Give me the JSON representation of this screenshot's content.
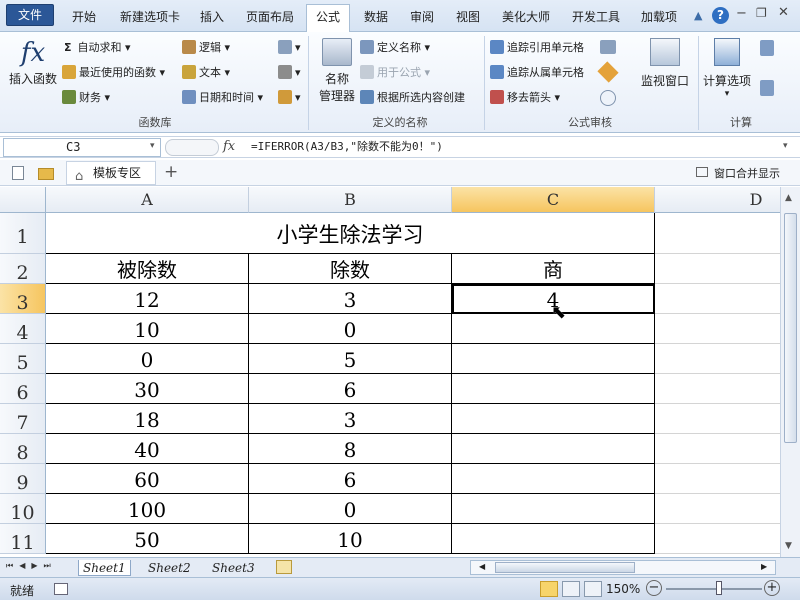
{
  "ribbon_tabs": [
    "文件",
    "开始",
    "新建选项卡",
    "插入",
    "页面布局",
    "公式",
    "数据",
    "审阅",
    "视图",
    "美化大师",
    "开发工具",
    "加载项"
  ],
  "active_tab": "公式",
  "ribbon": {
    "insert_function": "插入函数",
    "fx_glyph": "fx",
    "autosum": "自动求和",
    "recent": "最近使用的函数",
    "finance": "财务",
    "logic": "逻辑",
    "text": "文本",
    "datetime": "日期和时间",
    "group_funclib": "函数库",
    "name_mgr_1": "名称",
    "name_mgr_2": "管理器",
    "define_name": "定义名称",
    "use_in_formula": "用于公式",
    "create_from_sel": "根据所选内容创建",
    "group_names": "定义的名称",
    "trace_precedents": "追踪引用单元格",
    "trace_dependents": "追踪从属单元格",
    "remove_arrows": "移去箭头",
    "watch_window": "监视窗口",
    "group_audit": "公式审核",
    "calc_options": "计算选项",
    "group_calc": "计算"
  },
  "formula_bar": {
    "name_box": "C3",
    "fx_label": "fx",
    "formula": "=IFERROR(A3/B3,\"除数不能为0！\")"
  },
  "workbook_tabs": {
    "tab_label": "模板专区",
    "add": "+",
    "window_merge": "窗口合并显示"
  },
  "columns": [
    "A",
    "B",
    "C",
    "D"
  ],
  "rows": [
    "1",
    "2",
    "3",
    "4",
    "5",
    "6",
    "7",
    "8",
    "9",
    "10",
    "11"
  ],
  "sheet": {
    "title": "小学生除法学习",
    "headers": [
      "被除数",
      "除数",
      "商"
    ],
    "data": [
      [
        "12",
        "3",
        "4"
      ],
      [
        "10",
        "0",
        ""
      ],
      [
        "0",
        "5",
        ""
      ],
      [
        "30",
        "6",
        ""
      ],
      [
        "18",
        "3",
        ""
      ],
      [
        "40",
        "8",
        ""
      ],
      [
        "60",
        "6",
        ""
      ],
      [
        "100",
        "0",
        ""
      ],
      [
        "50",
        "10",
        ""
      ]
    ]
  },
  "sheet_tabs": [
    "Sheet1",
    "Sheet2",
    "Sheet3"
  ],
  "status": {
    "ready": "就绪",
    "zoom": "150%",
    "zoom_minus": "−",
    "zoom_plus": "+"
  },
  "colors": {
    "accent": "#2b5797",
    "grid_border": "#000000"
  }
}
